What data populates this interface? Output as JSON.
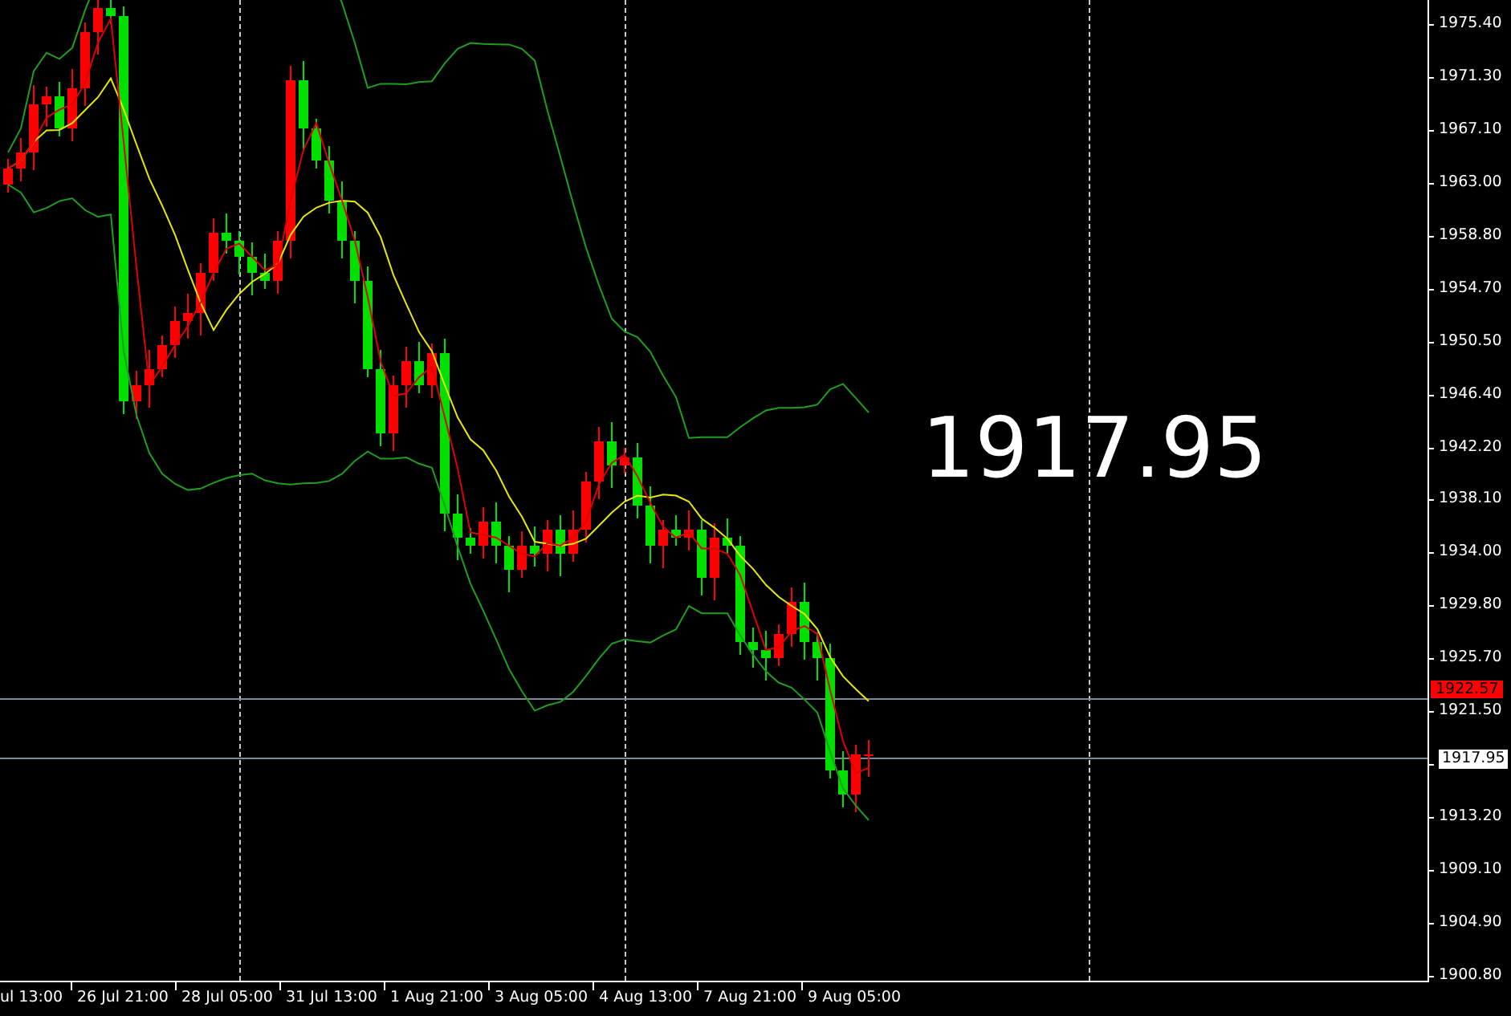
{
  "price_overlay": "1917.95",
  "price_axis": [
    {
      "kind": "tick",
      "label": "1975.40"
    },
    {
      "kind": "tick",
      "label": "1971.30"
    },
    {
      "kind": "tick",
      "label": "1967.10"
    },
    {
      "kind": "tick",
      "label": "1963.00"
    },
    {
      "kind": "tick",
      "label": "1958.80"
    },
    {
      "kind": "tick",
      "label": "1954.70"
    },
    {
      "kind": "tick",
      "label": "1950.50"
    },
    {
      "kind": "tick",
      "label": "1946.40"
    },
    {
      "kind": "tick",
      "label": "1942.20"
    },
    {
      "kind": "tick",
      "label": "1938.10"
    },
    {
      "kind": "tick",
      "label": "1934.00"
    },
    {
      "kind": "tick",
      "label": "1929.80"
    },
    {
      "kind": "tick",
      "label": "1925.70"
    },
    {
      "kind": "tick",
      "label": "1921.50"
    },
    {
      "kind": "tag",
      "label": "1917.95"
    },
    {
      "kind": "tick",
      "label": "1913.20"
    },
    {
      "kind": "tick",
      "label": "1909.10"
    },
    {
      "kind": "tick",
      "label": "1904.90"
    },
    {
      "kind": "tick",
      "label": "1900.80"
    }
  ],
  "ask_tag": "1922.57",
  "time_axis": [
    "ul 13:00",
    "26 Jul 21:00",
    "28 Jul 05:00",
    "31 Jul 13:00",
    "1 Aug 21:00",
    "3 Aug 05:00",
    "4 Aug 13:00",
    "7 Aug 21:00",
    "9 Aug 05:00"
  ]
}
